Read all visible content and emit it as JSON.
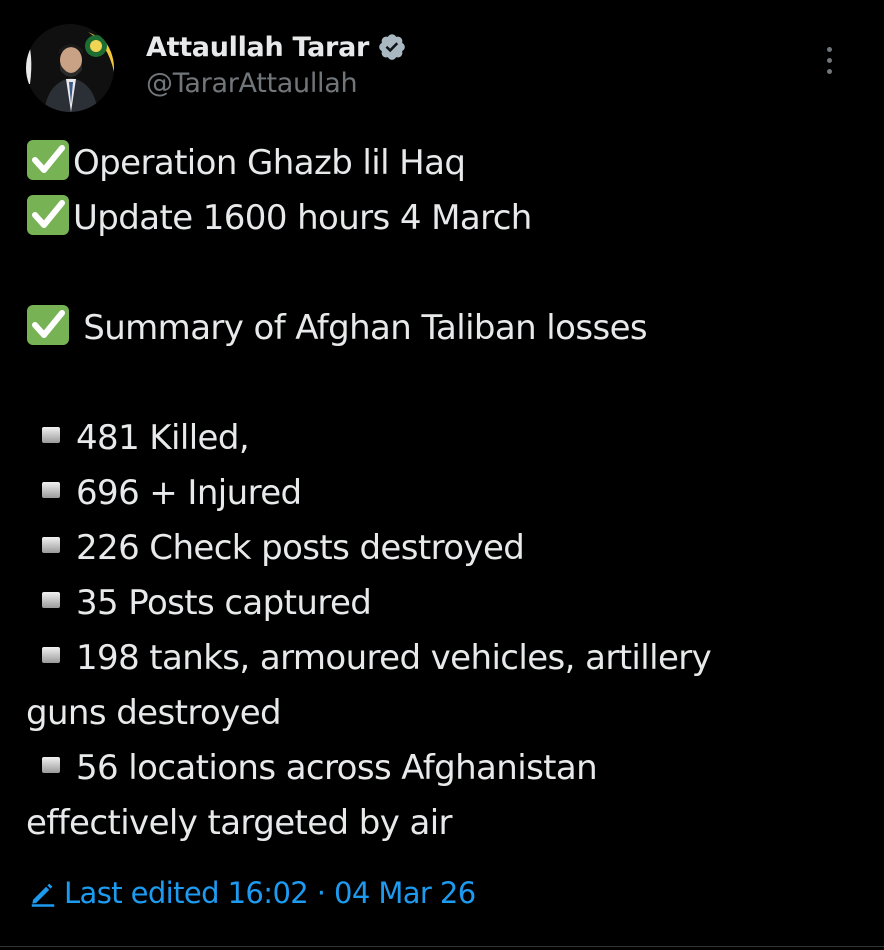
{
  "author": {
    "display_name": "Attaullah Tarar",
    "handle": "@TararAttaullah",
    "verified": true,
    "avatar_icon": "profile-photo"
  },
  "tweet": {
    "lines": [
      "Operation Ghazb lil Haq",
      "Update 1600 hours 4 March",
      "Summary of Afghan Taliban losses"
    ],
    "bullets": [
      "481 Killed,",
      "696 + Injured",
      "226 Check posts destroyed",
      "35 Posts captured",
      "198 tanks, armoured vehicles, artillery",
      "guns destroyed",
      "56 locations across Afghanistan",
      "effectively targeted by air"
    ]
  },
  "footer": {
    "edited_label": "Last edited 16:02 · 04 Mar 26"
  },
  "colors": {
    "background": "#000000",
    "text": "#e7e9ea",
    "secondary": "#71767b",
    "accent": "#1d9bf0",
    "check_green": "#77b255"
  },
  "icons": {
    "check": "check-mark-button-icon",
    "verified": "verified-badge-icon",
    "more": "more-options-icon",
    "edit": "pencil-icon",
    "bullet": "black-small-square-icon"
  }
}
